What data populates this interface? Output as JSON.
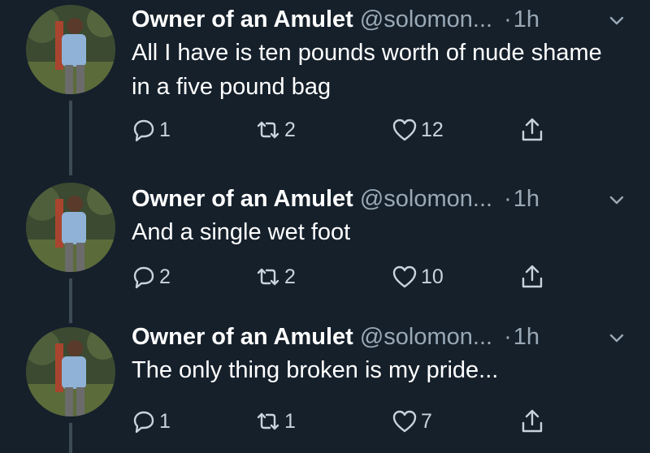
{
  "tweets": [
    {
      "display_name": "Owner of an Amulet",
      "handle": "@solomon...",
      "separator": "·",
      "time": "1h",
      "text": "All I have is ten pounds worth of nude shame in a five pound bag",
      "replies": "1",
      "retweets": "2",
      "likes": "12"
    },
    {
      "display_name": "Owner of an Amulet",
      "handle": "@solomon...",
      "separator": "·",
      "time": "1h",
      "text": "And a single wet foot",
      "replies": "2",
      "retweets": "2",
      "likes": "10"
    },
    {
      "display_name": "Owner of an Amulet",
      "handle": "@solomon...",
      "separator": "·",
      "time": "1h",
      "text": "The only thing broken is my pride...",
      "replies": "1",
      "retweets": "1",
      "likes": "7"
    }
  ],
  "icons": {
    "reply": "reply-icon",
    "retweet": "retweet-icon",
    "like": "heart-icon",
    "share": "share-icon",
    "caret": "chevron-down-icon"
  },
  "colors": {
    "background": "#15202b",
    "text": "#ffffff",
    "muted": "#9aa9b6",
    "thread_line": "#3d4b57"
  }
}
